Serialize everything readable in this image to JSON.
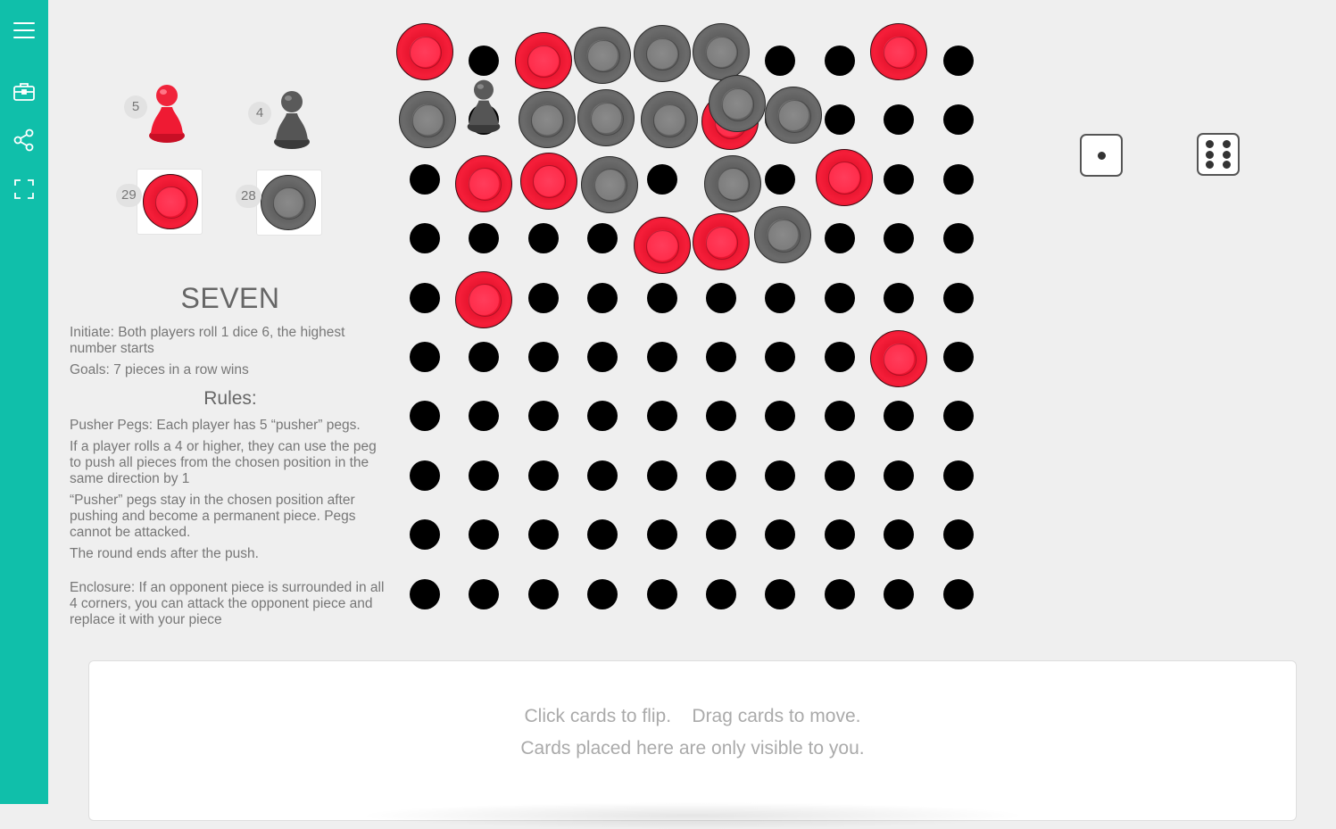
{
  "sidebar": {
    "items": [
      {
        "icon": "menu-icon"
      },
      {
        "icon": "toolbox-icon"
      },
      {
        "icon": "share-icon"
      },
      {
        "icon": "fullscreen-icon"
      }
    ],
    "color": "#10bfaa"
  },
  "players": {
    "red": {
      "pawn_count": "5",
      "piece_count": "29",
      "color": "#f51e39"
    },
    "gray": {
      "pawn_count": "4",
      "piece_count": "28",
      "color": "#6b6b6b"
    }
  },
  "rules": {
    "title": "SEVEN",
    "initiate": "Initiate: Both players roll 1 dice 6, the highest number starts",
    "goals": "Goals: 7 pieces in a row wins",
    "heading": "Rules:",
    "pusher": "Pusher Pegs: Each player has 5 “pusher” pegs.",
    "push_rule": "If a player rolls a 4 or higher, they can use the peg to push all pieces from the chosen position in the same direction by 1",
    "pusher_stay": "“Pusher” pegs stay in the chosen position after pushing and become a permanent piece. Pegs cannot be attacked.",
    "round_end": "The round ends after the push.",
    "enclosure": "Enclosure: If an opponent piece is surrounded in all 4 corners, you can attack the opponent piece and replace it with your piece"
  },
  "board": {
    "rows": 10,
    "cols": 10,
    "pieces": [
      {
        "color": "red",
        "row": 0,
        "col": 0
      },
      {
        "color": "red",
        "row": 0,
        "col": 2
      },
      {
        "color": "gray",
        "row": 0,
        "col": 3
      },
      {
        "color": "gray",
        "row": 0,
        "col": 4
      },
      {
        "color": "gray",
        "row": 0,
        "col": 5
      },
      {
        "color": "red",
        "row": 0,
        "col": 8
      },
      {
        "color": "gray",
        "row": 1,
        "col": 0
      },
      {
        "color": "gray",
        "row": 1,
        "col": 2
      },
      {
        "color": "gray",
        "row": 1,
        "col": 3
      },
      {
        "color": "gray",
        "row": 1,
        "col": 4
      },
      {
        "color": "red",
        "row": 1,
        "col": 5
      },
      {
        "color": "gray",
        "row": 1,
        "col": 5
      },
      {
        "color": "gray",
        "row": 1,
        "col": 6
      },
      {
        "color": "red",
        "row": 2,
        "col": 1
      },
      {
        "color": "red",
        "row": 2,
        "col": 2
      },
      {
        "color": "gray",
        "row": 2,
        "col": 3
      },
      {
        "color": "gray",
        "row": 2,
        "col": 5
      },
      {
        "color": "red",
        "row": 2,
        "col": 7
      },
      {
        "color": "red",
        "row": 3,
        "col": 4
      },
      {
        "color": "red",
        "row": 3,
        "col": 5
      },
      {
        "color": "gray",
        "row": 3,
        "col": 6
      },
      {
        "color": "red",
        "row": 4,
        "col": 1
      },
      {
        "color": "red",
        "row": 5,
        "col": 8
      }
    ],
    "pegs": [
      {
        "color": "gray",
        "row": 1,
        "col": 1
      }
    ]
  },
  "dice": [
    {
      "value": 1
    },
    {
      "value": 6
    }
  ],
  "hand": {
    "line1": "Click cards to flip.    Drag cards to move.",
    "line2": "Cards placed here are only visible to you."
  }
}
